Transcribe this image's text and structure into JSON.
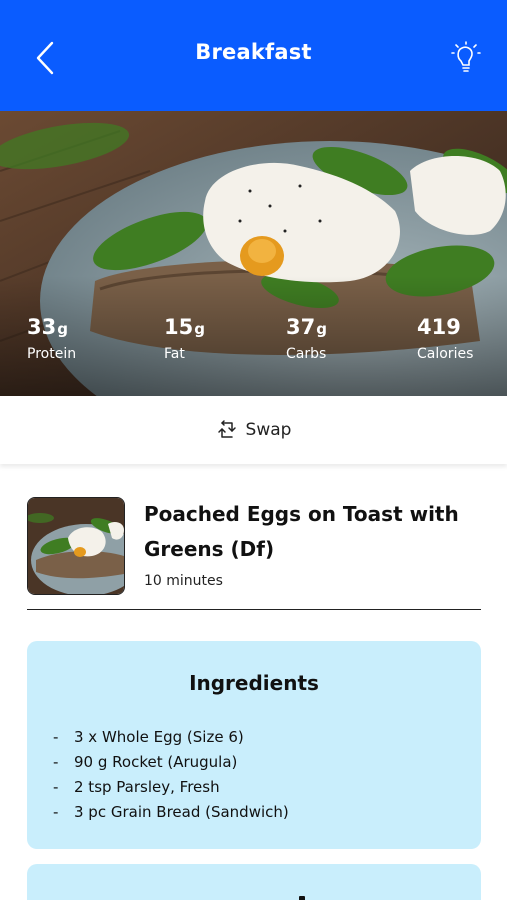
{
  "header": {
    "title": "Breakfast",
    "back_icon": "chevron-left-icon",
    "tip_icon": "lightbulb-icon",
    "background": "#0a5cff"
  },
  "macros": [
    {
      "value": "33",
      "unit": "g",
      "label": "Protein"
    },
    {
      "value": "15",
      "unit": "g",
      "label": "Fat"
    },
    {
      "value": "37",
      "unit": "g",
      "label": "Carbs"
    },
    {
      "value": "419",
      "unit": "",
      "label": "Calories"
    }
  ],
  "swap": {
    "label": "Swap",
    "icon": "swap-icon"
  },
  "recipe": {
    "name": "Poached Eggs on Toast with Greens (Df)",
    "time": "10 minutes"
  },
  "ingredients": {
    "heading": "Ingredients",
    "card_color": "#c9eefc",
    "items": [
      "3 x Whole Egg (Size 6)",
      "90 g Rocket (Arugula)",
      "2 tsp Parsley, Fresh",
      "3 pc Grain Bread (Sandwich)"
    ]
  }
}
